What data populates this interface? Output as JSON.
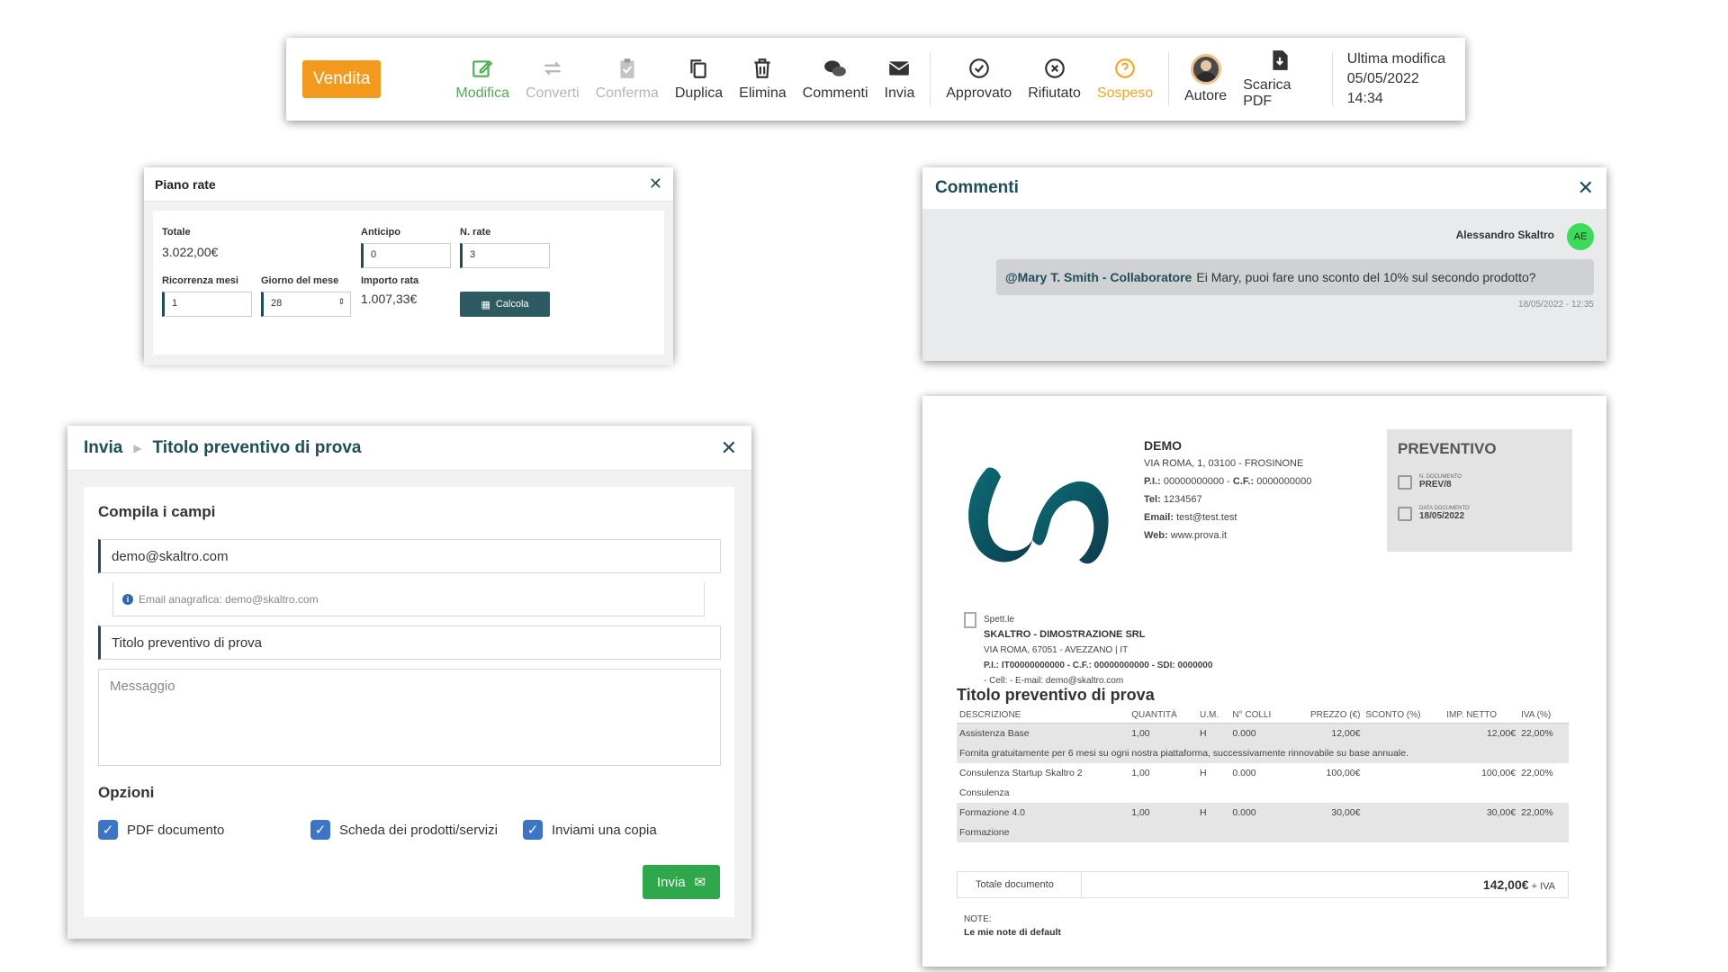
{
  "toolbar": {
    "vendita_label": "Vendita",
    "items": [
      {
        "label": "Modifica",
        "icon": "edit-icon"
      },
      {
        "label": "Converti",
        "icon": "convert-icon"
      },
      {
        "label": "Conferma",
        "icon": "confirm-icon"
      },
      {
        "label": "Duplica",
        "icon": "duplicate-icon"
      },
      {
        "label": "Elimina",
        "icon": "trash-icon"
      },
      {
        "label": "Commenti",
        "icon": "comments-icon"
      },
      {
        "label": "Invia",
        "icon": "envelope-icon"
      },
      {
        "label": "Approvato",
        "icon": "check-circle-icon"
      },
      {
        "label": "Rifiutato",
        "icon": "x-circle-icon"
      },
      {
        "label": "Sospeso",
        "icon": "question-circle-icon"
      },
      {
        "label": "Autore",
        "icon": "avatar"
      },
      {
        "label": "Scarica PDF",
        "icon": "download-pdf-icon"
      }
    ],
    "last_modified_label": "Ultima modifica",
    "last_modified_value": "05/05/2022 14:34",
    "colors": {
      "vendita": "#f39a1e",
      "active": "#4caf50",
      "sospeso": "#f5a623"
    }
  },
  "piano_rate": {
    "title": "Piano rate",
    "totale_label": "Totale",
    "totale_value": "3.022,00€",
    "anticipo_label": "Anticipo",
    "anticipo_value": "0",
    "n_rate_label": "N. rate",
    "n_rate_value": "3",
    "ricorrenza_label": "Ricorrenza mesi",
    "ricorrenza_value": "1",
    "giorno_label": "Giorno del mese",
    "giorno_value": "28",
    "importo_label": "Importo rata",
    "importo_value": "1.007,33€",
    "calcola_label": "Calcola"
  },
  "commenti": {
    "title": "Commenti",
    "author": "Alessandro Skaltro",
    "author_initials": "AE",
    "mention": "@Mary T. Smith - Collaboratore",
    "message": "Ei Mary, puoi fare uno sconto del 10% sul secondo prodotto?",
    "timestamp": "18/05/2022 - 12:35"
  },
  "invia": {
    "breadcrumb_root": "Invia",
    "breadcrumb_title": "Titolo preventivo di prova",
    "section_title": "Compila i campi",
    "email_value": "demo@skaltro.com",
    "email_hint": "Email anagrafica: demo@skaltro.com",
    "subject_value": "Titolo preventivo di prova",
    "message_placeholder": "Messaggio",
    "options_title": "Opzioni",
    "options": [
      {
        "label": "PDF documento",
        "checked": true
      },
      {
        "label": "Scheda dei prodotti/servizi",
        "checked": true
      },
      {
        "label": "Inviami una copia",
        "checked": true
      }
    ],
    "send_label": "Invia"
  },
  "documento": {
    "company_name": "DEMO",
    "company_address": "VIA ROMA, 1, 03100 - FROSINONE",
    "company_pi_label": "P.I.:",
    "company_pi": "00000000000",
    "company_cf_label": "C.F.:",
    "company_cf": "0000000000",
    "company_tel_label": "Tel:",
    "company_tel": "1234567",
    "company_email_label": "Email:",
    "company_email": "test@test.test",
    "company_web_label": "Web:",
    "company_web": "www.prova.it",
    "doc_type": "PREVENTIVO",
    "n_documento_label": "N. DOCUMENTO",
    "n_documento": "PREV/8",
    "data_documento_label": "DATA DOCUMENTO",
    "data_documento": "18/05/2022",
    "client_prefix": "Spett.le",
    "client_name": "SKALTRO - DIMOSTRAZIONE SRL",
    "client_address": "VIA ROMA, 67051 - AVEZZANO | IT",
    "client_ids": "P.I.: IT00000000000 - C.F.: 00000000000 - SDI: 0000000",
    "client_contacts": "- Cell:  - E-mail: demo@skaltro.com",
    "title": "Titolo preventivo di prova",
    "columns": [
      "DESCRIZIONE",
      "QUANTITÀ",
      "U.M.",
      "N° COLLI",
      "PREZZO (€)",
      "SCONTO (%)",
      "IMP. NETTO",
      "IVA (%)"
    ],
    "rows": [
      {
        "desc": "Assistenza Base",
        "qty": "1,00",
        "um": "H",
        "colli": "0.000",
        "prezzo": "12,00€",
        "sconto": "",
        "netto": "12,00€",
        "iva": "22,00%",
        "note": "Fornita gratuitamente per 6 mesi su ogni nostra piattaforma, successivamente rinnovabile su base annuale."
      },
      {
        "desc": "Consulenza Startup Skaltro 2",
        "qty": "1,00",
        "um": "H",
        "colli": "0.000",
        "prezzo": "100,00€",
        "sconto": "",
        "netto": "100,00€",
        "iva": "22,00%",
        "note": "Consulenza"
      },
      {
        "desc": "Formazione 4.0",
        "qty": "1,00",
        "um": "H",
        "colli": "0.000",
        "prezzo": "30,00€",
        "sconto": "",
        "netto": "30,00€",
        "iva": "22,00%",
        "note": "Formazione"
      }
    ],
    "totale_label": "Totale documento",
    "totale_value": "142,00€",
    "totale_suffix": "+ IVA",
    "note_label": "NOTE:",
    "note_value": "Le mie note di default"
  }
}
